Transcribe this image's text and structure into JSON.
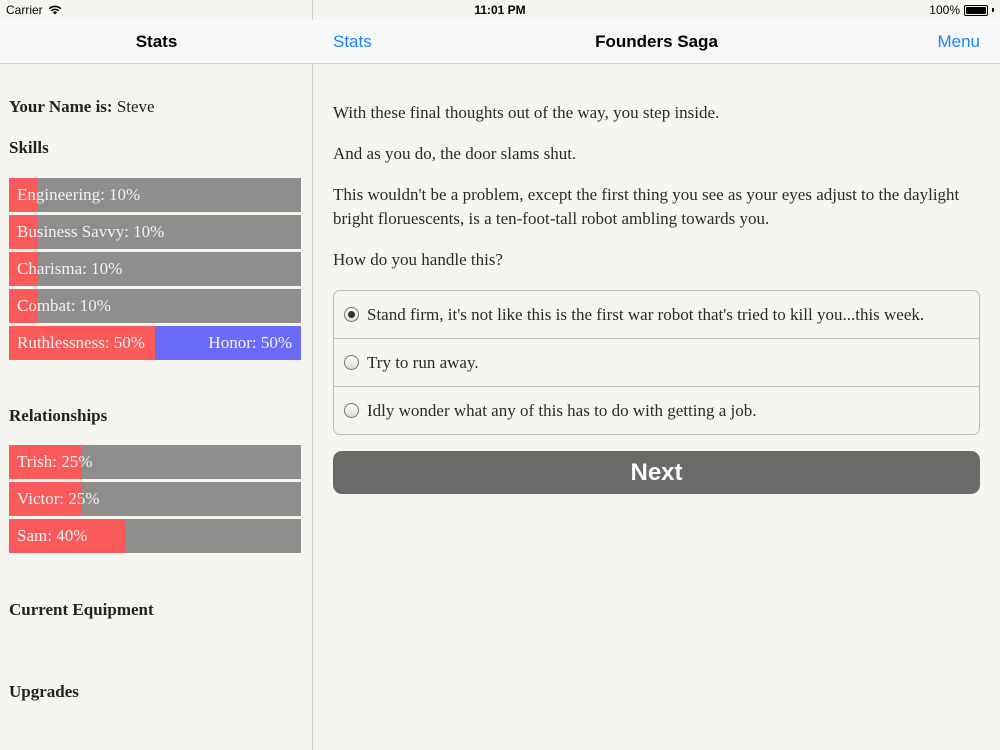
{
  "status_bar": {
    "carrier": "Carrier",
    "time": "11:01 PM",
    "battery": "100%"
  },
  "left_nav": {
    "title": "Stats"
  },
  "right_nav": {
    "back_label": "Stats",
    "title": "Founders Saga",
    "menu_label": "Menu"
  },
  "stats": {
    "name_label": "Your Name is:",
    "name_value": "Steve",
    "skills_heading": "Skills",
    "skills": [
      {
        "label": "Engineering: 10%",
        "value": 0.1
      },
      {
        "label": "Business Savvy: 10%",
        "value": 0.1
      },
      {
        "label": "Charisma: 10%",
        "value": 0.1
      },
      {
        "label": "Combat: 10%",
        "value": 0.1
      }
    ],
    "ruthlessness": {
      "label": "Ruthlessness: 50%",
      "value": 0.5
    },
    "honor": {
      "label": "Honor: 50%",
      "value": 0.5
    },
    "relationships_heading": "Relationships",
    "relationships": [
      {
        "label": "Trish: 25%",
        "value": 0.25
      },
      {
        "label": "Victor: 25%",
        "value": 0.25
      },
      {
        "label": "Sam: 40%",
        "value": 0.4
      }
    ],
    "equipment_heading": "Current Equipment",
    "upgrades_heading": "Upgrades"
  },
  "story": {
    "paragraphs": [
      "With these final thoughts out of the way, you step inside.",
      "And as you do, the door slams shut.",
      "This wouldn't be a problem, except the first thing you see as your eyes adjust to the daylight bright floruescents, is a ten-foot-tall robot ambling towards you.",
      "How do you handle this?"
    ],
    "choices": [
      {
        "label": "Stand firm, it's not like this is the first war robot that's tried to kill you...this week.",
        "selected": true
      },
      {
        "label": "Try to run away.",
        "selected": false
      },
      {
        "label": "Idly wonder what any of this has to do with getting a job.",
        "selected": false
      }
    ],
    "next_label": "Next"
  },
  "colors": {
    "skill_fill": "#fb5a5a",
    "honor_fill": "#6b6bfa",
    "bar_bg": "#8f8e8d",
    "link": "#1a82fb",
    "next_bg": "#6b6a68"
  }
}
